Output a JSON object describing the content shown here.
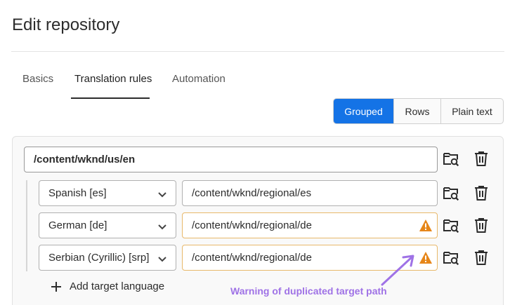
{
  "page": {
    "title": "Edit repository"
  },
  "tabs": [
    {
      "label": "Basics",
      "selected": false
    },
    {
      "label": "Translation rules",
      "selected": true
    },
    {
      "label": "Automation",
      "selected": false
    }
  ],
  "view_toggle": {
    "options": [
      "Grouped",
      "Rows",
      "Plain text"
    ],
    "active": "Grouped"
  },
  "source": {
    "path": "/content/wknd/us/en"
  },
  "targets": [
    {
      "language": "Spanish [es]",
      "path": "/content/wknd/regional/es",
      "warning": false
    },
    {
      "language": "German [de]",
      "path": "/content/wknd/regional/de",
      "warning": true
    },
    {
      "language": "Serbian (Cyrillic) [srp]",
      "path": "/content/wknd/regional/de",
      "warning": true
    }
  ],
  "add_target_label": "Add target language",
  "annotation": {
    "text": "Warning of duplicated target path"
  },
  "icons": {
    "browse": "folder-search-icon",
    "delete": "trash-icon",
    "warning": "warning-icon",
    "chevron": "chevron-down-icon",
    "add": "plus-icon"
  },
  "colors": {
    "accent": "#1473e6",
    "warning": "#e68619",
    "annotation": "#9f72e6"
  }
}
